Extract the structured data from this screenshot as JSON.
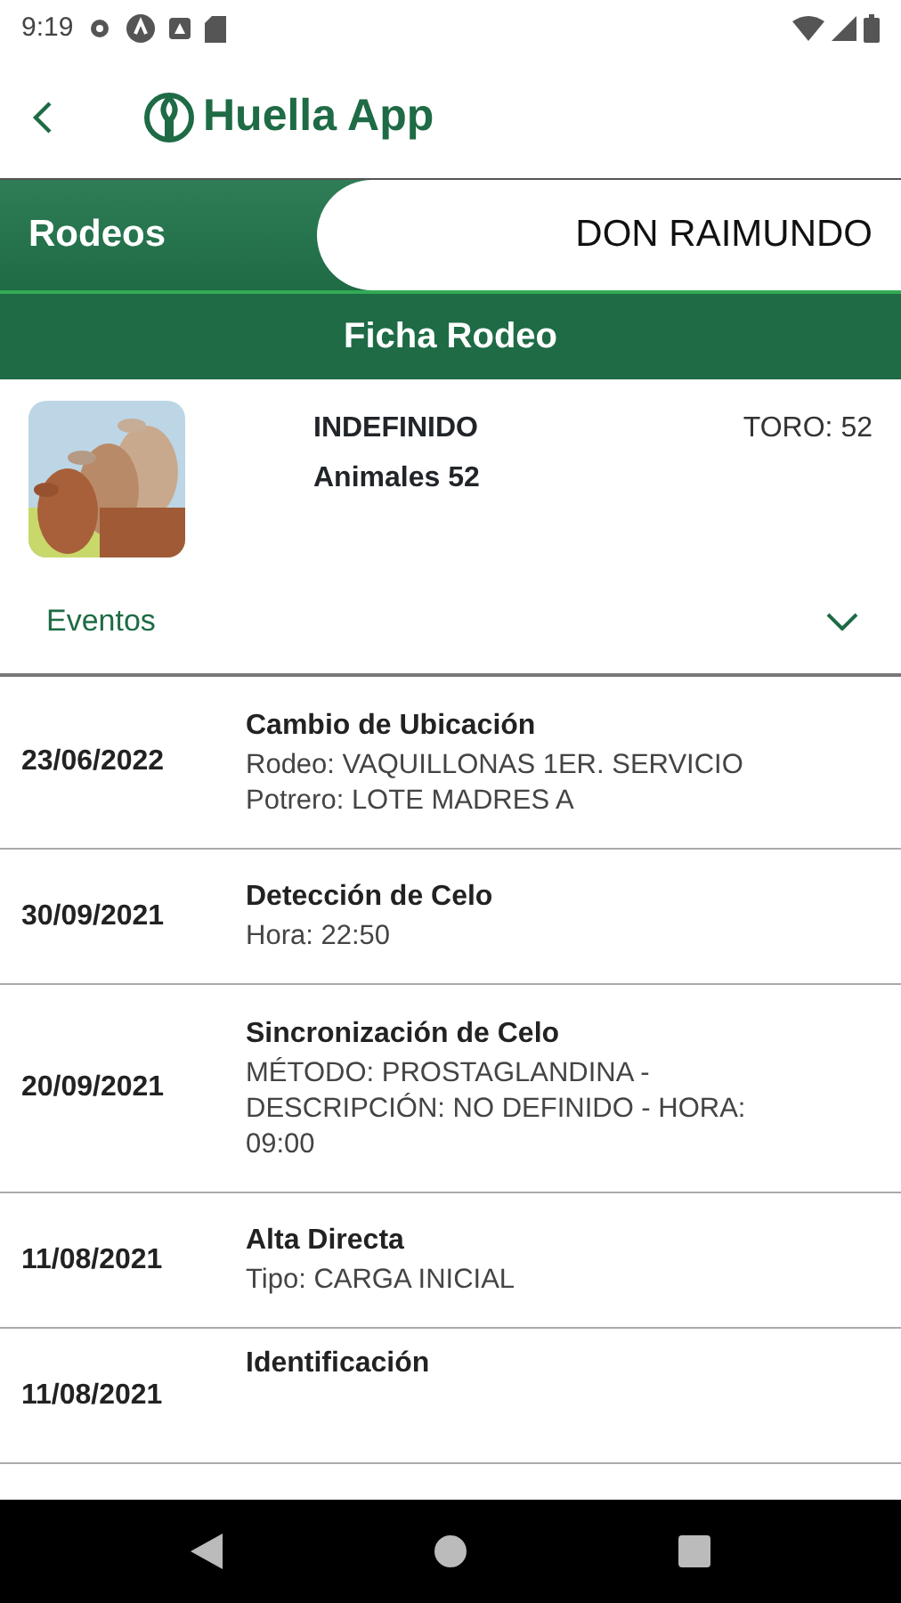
{
  "status_bar": {
    "time": "9:19"
  },
  "app_bar": {
    "title": "Huella App"
  },
  "breadcrumb": {
    "section": "Rodeos",
    "establishment": "DON RAIMUNDO"
  },
  "page_title": "Ficha Rodeo",
  "herd": {
    "kind": "picture",
    "category": "INDEFINIDO",
    "animals": "Animales 52",
    "bull": "TORO: 52"
  },
  "events_section": {
    "label": "Eventos",
    "expanded": true
  },
  "events": [
    {
      "date": "23/06/2022",
      "title": "Cambio de Ubicación",
      "details": [
        "Rodeo: VAQUILLONAS 1ER. SERVICIO",
        "Potrero: LOTE MADRES A"
      ]
    },
    {
      "date": "30/09/2021",
      "title": "Detección de Celo",
      "details": [
        "Hora: 22:50"
      ]
    },
    {
      "date": "20/09/2021",
      "title": "Sincronización de Celo",
      "details": [
        "MÉTODO: PROSTAGLANDINA - DESCRIPCIÓN: NO DEFINIDO - HORA: 09:00"
      ]
    },
    {
      "date": "11/08/2021",
      "title": "Alta Directa",
      "details": [
        "Tipo: CARGA INICIAL"
      ]
    },
    {
      "date": "11/08/2021",
      "title": "Identificación"
    }
  ]
}
